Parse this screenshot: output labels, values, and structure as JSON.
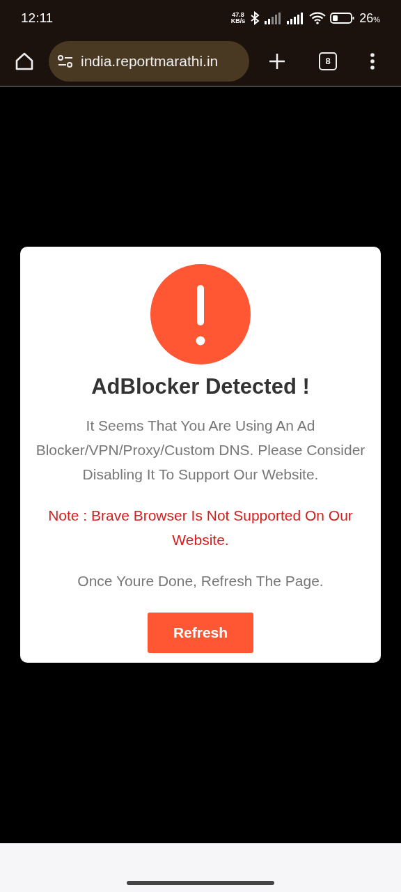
{
  "status_bar": {
    "time": "12:11",
    "net_speed": "47.8",
    "net_unit": "KB/s",
    "battery_level": "26",
    "battery_unit": "%"
  },
  "toolbar": {
    "url": "india.reportmarathi.in",
    "tab_count": "8"
  },
  "dialog": {
    "title": "AdBlocker Detected !",
    "message": "It Seems That You Are Using An Ad Blocker/VPN/Proxy/Custom DNS. Please Consider Disabling It To Support Our Website.",
    "note": "Note : Brave Browser Is Not Supported On Our Website.",
    "instruction": "Once Youre Done, Refresh The Page.",
    "button": "Refresh"
  }
}
